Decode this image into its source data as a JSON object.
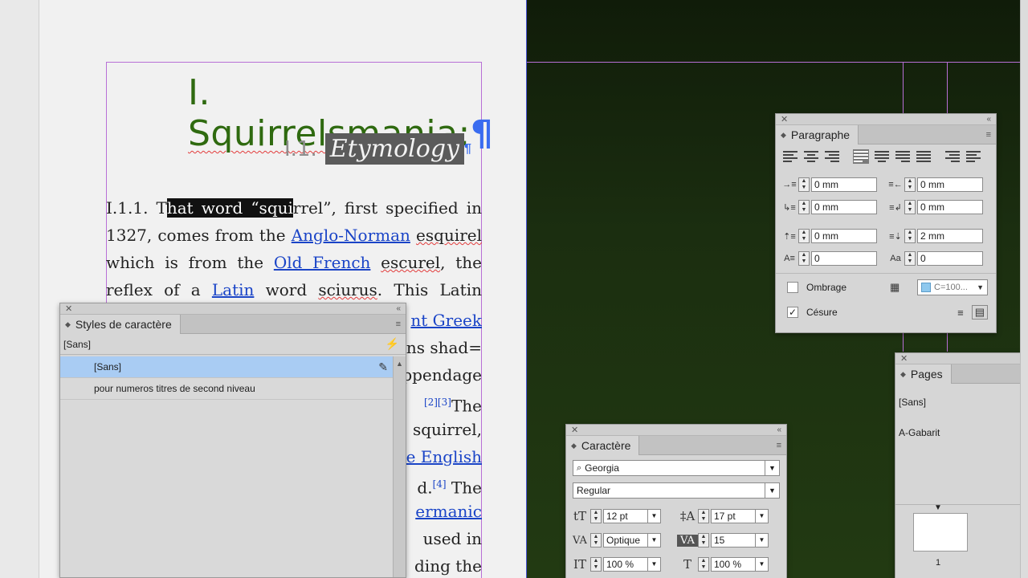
{
  "document": {
    "heading1": {
      "number": "I.",
      "title": "Squirrelsmania",
      "trail": ":"
    },
    "heading2": {
      "number": "I.1.",
      "title": "Etymology"
    },
    "lines": [
      {
        "pre": "I.1.1. T",
        "sel": "hat word “squi",
        "post": "rrel”, first specified in"
      },
      {
        "pre": "1327, comes from the ",
        "link": "Anglo-Norman",
        "mid": " ",
        "wavy": "esquirel"
      },
      {
        "pre": "which is from the ",
        "link": "Old French",
        "mid": " ",
        "wavy": "escurel",
        "post": ", the"
      },
      {
        "pre": "reflex of a ",
        "link": "Latin",
        "mid": " word ",
        "wavy": "sciurus",
        "post": ". This Latin"
      }
    ],
    "hidden_right": [
      {
        "link": "nt Greek"
      },
      {
        "text": "ans shad="
      },
      {
        "text": "ppendage"
      },
      {
        "sup": "[2][3]",
        "text": "The"
      },
      {
        "text": "squirrel,"
      },
      {
        "link": "e English"
      },
      {
        "text": "d.",
        "sup": "[4]",
        "post": " The"
      },
      {
        "link": "ermanic"
      },
      {
        "text": " used in"
      },
      {
        "text": "ding the"
      }
    ]
  },
  "panels": {
    "styles": {
      "title": "Styles de caractère",
      "current": "[Sans]",
      "items": [
        "[Sans]",
        "pour numeros titres de second niveau"
      ]
    },
    "paragraphe": {
      "title": "Paragraphe",
      "left_indent": "0 mm",
      "right_indent": "0 mm",
      "first_line_indent": "0 mm",
      "last_line_indent": "0 mm",
      "space_before": "0 mm",
      "space_after": "2 mm",
      "dropcap_lines": "0",
      "dropcap_chars": "0",
      "ombrage_label": "Ombrage",
      "swatch_value": "C=100...",
      "cesure_label": "Césure",
      "cesure_checked": true
    },
    "pages": {
      "title": "Pages",
      "masters": [
        "[Sans]",
        "A-Gabarit"
      ],
      "page_number": "1"
    },
    "caractere": {
      "title": "Caractère",
      "font": "Georgia",
      "style": "Regular",
      "size": "12 pt",
      "leading": "17 pt",
      "kerning": "Optique",
      "tracking": "15",
      "vscale": "100 %",
      "hscale": "100 %"
    }
  },
  "colors": {
    "heading": "#2f6a10",
    "link": "#1a44c7",
    "selection": "#a9ccf3",
    "guides": "#b86fd6"
  }
}
